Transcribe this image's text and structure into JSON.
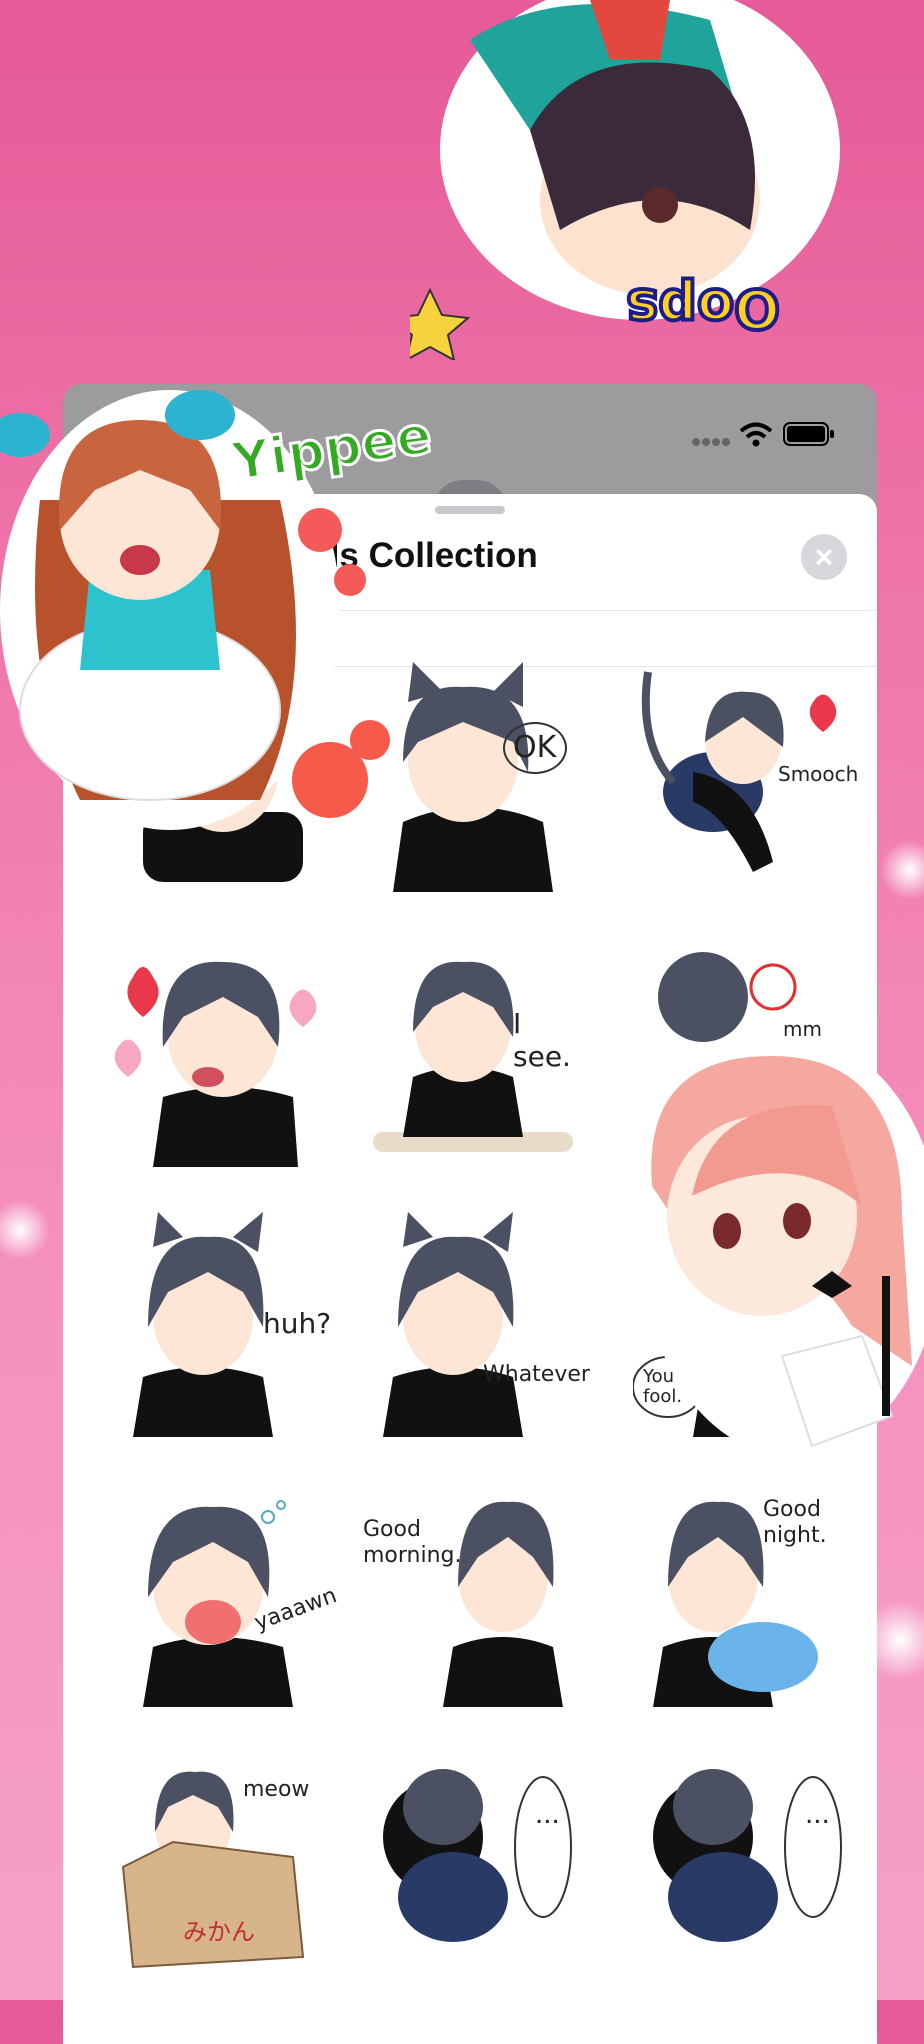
{
  "sheet": {
    "title": "Cat Girls Collection",
    "close_label": "×"
  },
  "status_bar": {
    "signal_icon": "signal-dots-icon",
    "wifi_icon": "wifi-icon",
    "battery_icon": "battery-icon"
  },
  "floating_stickers": {
    "top": "Oops",
    "left": "Yippee"
  },
  "stickers": [
    {
      "caption": ""
    },
    {
      "caption": "OK"
    },
    {
      "caption": "Smooch"
    },
    {
      "caption": ""
    },
    {
      "caption": "I see."
    },
    {
      "caption": "mm"
    },
    {
      "caption": "huh?"
    },
    {
      "caption": "Whatever"
    },
    {
      "caption": "You fool."
    },
    {
      "caption": "yaaawn"
    },
    {
      "caption": "Good morning."
    },
    {
      "caption": "Good night."
    },
    {
      "caption": "meow"
    },
    {
      "caption": "..."
    },
    {
      "caption": "..."
    }
  ],
  "box_label": "みかん",
  "colors": {
    "background": "#ee6fa6",
    "sheet": "#ffffff",
    "close_button": "#d8d8dc"
  }
}
